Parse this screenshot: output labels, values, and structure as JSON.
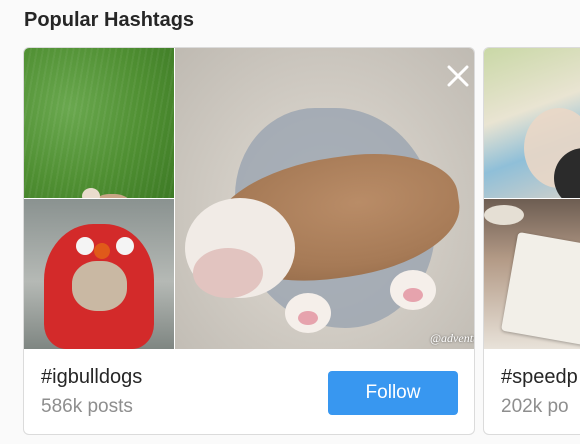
{
  "section": {
    "title": "Popular Hashtags"
  },
  "cards": [
    {
      "hashtag": "#igbulldogs",
      "posts": "586k posts",
      "follow_label": "Follow",
      "watermark": "@adventuresofcharliethebulldog",
      "close_icon": "close-icon"
    },
    {
      "hashtag": "#speedp",
      "posts": "202k po"
    }
  ],
  "colors": {
    "accent": "#3897f0",
    "text": "#262626",
    "muted": "#8e8e8e",
    "border": "#dbdbdb",
    "background": "#fafafa"
  }
}
